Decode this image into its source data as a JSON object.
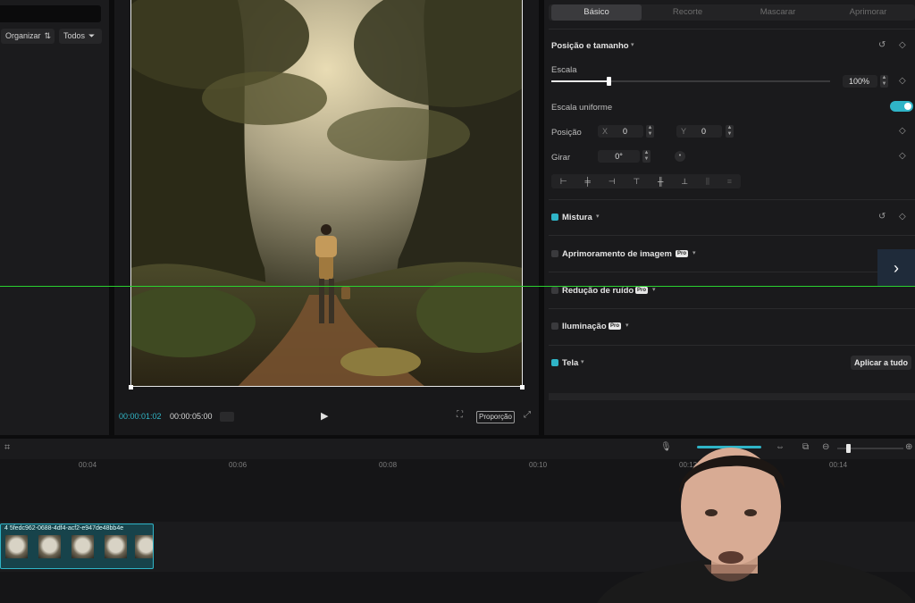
{
  "left_panel": {
    "organize_label": "Organizar",
    "all_label": "Todos"
  },
  "player": {
    "current_time": "00:00:01:02",
    "total_time": "00:00:05:00",
    "ratio_label": "Proporção"
  },
  "inspector": {
    "tabs": [
      "Básico",
      "Recorte",
      "Mascarar",
      "Aprimorar"
    ],
    "active_tab": "Básico",
    "position_size": {
      "title": "Posição e tamanho",
      "scale_label": "Escala",
      "scale_value": "100%",
      "scale_slider_fraction": 0.206,
      "uniform_scale_label": "Escala uniforme",
      "uniform_scale_on": true,
      "position_label": "Posição",
      "x_label": "X",
      "x_value": "0",
      "y_label": "Y",
      "y_value": "0",
      "rotate_label": "Girar",
      "rotate_value": "0°"
    },
    "sections": {
      "mix": "Mistura",
      "image_enhance": "Aprimoramento de imagem",
      "noise_reduction": "Redução de ruído",
      "lighting": "Iluminação",
      "canvas": "Tela"
    },
    "pro_badge": "Pro",
    "apply_all_label": "Aplicar a tudo"
  },
  "timeline": {
    "ticks": [
      "00:04",
      "00:06",
      "00:08",
      "00:10",
      "00:12",
      "00:14"
    ],
    "clip_label": "4  5fedc962-0688-4df4-acf2-e947de48bb4e"
  },
  "colors": {
    "accent": "#2fb4c7",
    "background": "#0c0c0d",
    "panel": "#1a1a1c"
  }
}
